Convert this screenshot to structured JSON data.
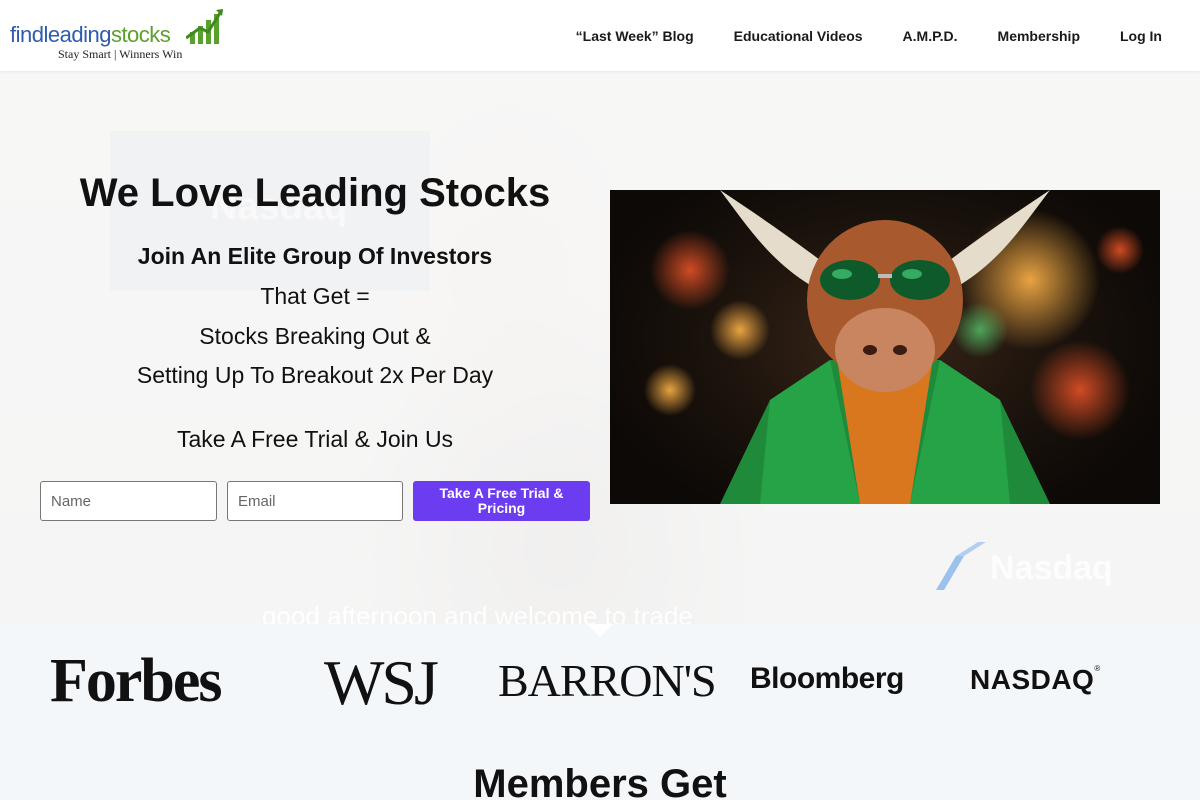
{
  "header": {
    "logo": {
      "word_part1": "findleading",
      "word_part2": "stocks",
      "tagline": "Stay Smart | Winners Win",
      "colors": {
        "blue": "#2f5bb0",
        "green": "#5aa02c"
      }
    },
    "nav": [
      {
        "label": "“Last Week” Blog"
      },
      {
        "label": "Educational Videos"
      },
      {
        "label": "A.M.P.D."
      },
      {
        "label": "Membership"
      },
      {
        "label": "Log In"
      }
    ]
  },
  "hero": {
    "title": "We Love Leading Stocks",
    "subtitle": "Join An Elite Group Of Investors",
    "lines": [
      "That Get =",
      "Stocks Breaking Out &",
      "Setting Up To Breakout 2x Per Day"
    ],
    "cta_text": "Take A Free Trial & Join Us",
    "form": {
      "name_placeholder": "Name",
      "email_placeholder": "Email",
      "button_label": "Take A Free Trial & Pricing"
    },
    "background_watermark_left": "Nasdaq",
    "background_watermark_right": "Nasdaq",
    "video_caption": "good afternoon and welcome to trade",
    "accent_color": "#6c3cf0"
  },
  "press": {
    "logos": [
      {
        "name": "Forbes"
      },
      {
        "name": "WSJ"
      },
      {
        "name": "BARRON'S"
      },
      {
        "name": "Bloomberg"
      },
      {
        "name": "NASDAQ",
        "registered": "®"
      }
    ]
  },
  "members": {
    "heading": "Members Get"
  }
}
